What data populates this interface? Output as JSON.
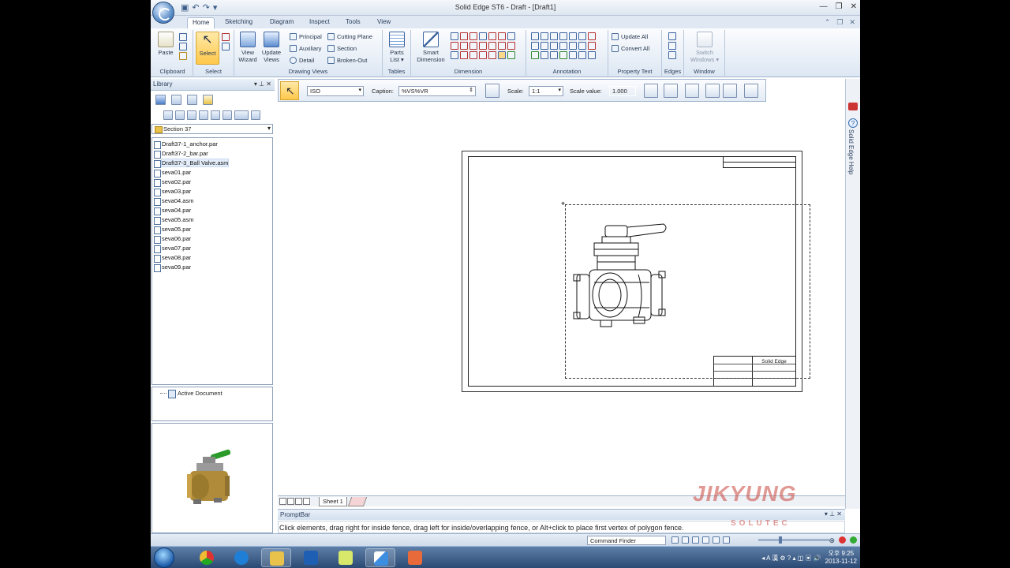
{
  "window": {
    "title": "Solid Edge ST6 - Draft - [Draft1]"
  },
  "tabs": [
    "Home",
    "Sketching",
    "Diagram",
    "Inspect",
    "Tools",
    "View"
  ],
  "ribbon": {
    "clipboard": {
      "label": "Clipboard",
      "paste": "Paste"
    },
    "select": {
      "label": "Select",
      "select": "Select"
    },
    "drawing_views": {
      "label": "Drawing Views",
      "view_wizard_1": "View",
      "view_wizard_2": "Wizard",
      "update_views_1": "Update",
      "update_views_2": "Views",
      "principal": "Principal",
      "auxiliary": "Auxiliary",
      "detail": "Detail",
      "cutting_plane": "Cutting Plane",
      "section": "Section",
      "broken_out": "Broken-Out"
    },
    "tables": {
      "label": "Tables",
      "parts_list_1": "Parts",
      "parts_list_2": "List ▾"
    },
    "dimension": {
      "label": "Dimension",
      "smart_1": "Smart",
      "smart_2": "Dimension"
    },
    "annotation": {
      "label": "Annotation"
    },
    "property_text": {
      "label": "Property Text",
      "update_all": "Update All",
      "convert_all": "Convert All"
    },
    "edges": {
      "label": "Edges"
    },
    "window_group": {
      "label": "Window",
      "switch_1": "Switch",
      "switch_2": "Windows ▾"
    }
  },
  "library": {
    "title": "Library",
    "folder": "Section 37",
    "files": [
      "Draft37-1_anchor.par",
      "Draft37-2_bar.par",
      "Draft37-3_Ball Valve.asm",
      "seva01.par",
      "seva02.par",
      "seva03.par",
      "seva04.asm",
      "seva04.par",
      "seva05.asm",
      "seva05.par",
      "seva06.par",
      "seva07.par",
      "seva08.par",
      "seva09.par"
    ],
    "active_document": "Active Document"
  },
  "draw_toolbar": {
    "standard": "ISO",
    "caption_label": "Caption:",
    "caption_value": "%VS%VR",
    "scale_label": "Scale:",
    "scale_value": "1:1",
    "scale_value_label": "Scale value:",
    "scale_value_num": "1.000"
  },
  "sheet": {
    "tab": "Sheet 1",
    "title_block_name": "Solid Edge"
  },
  "prompt": {
    "title": "PromptBar",
    "text": "Click elements, drag right for inside fence, drag left for inside/overlapping fence, or Alt+click to place first vertex of polygon fence."
  },
  "status": {
    "command_finder": "Command Finder"
  },
  "help_panel": {
    "label": "Solid Edge Help"
  },
  "watermark": {
    "line1": "JIKYUNG",
    "line2": "SOLUTEC"
  },
  "taskbar": {
    "time": "오후 9:25",
    "date": "2013-11-12"
  },
  "colors": {
    "ribbon_bg": "#dde7f3",
    "selected_button": "#ffc84a",
    "valve_handle": "#2a9a2a",
    "valve_body": "#b08c3a",
    "taskbar": "#2c4a73"
  }
}
